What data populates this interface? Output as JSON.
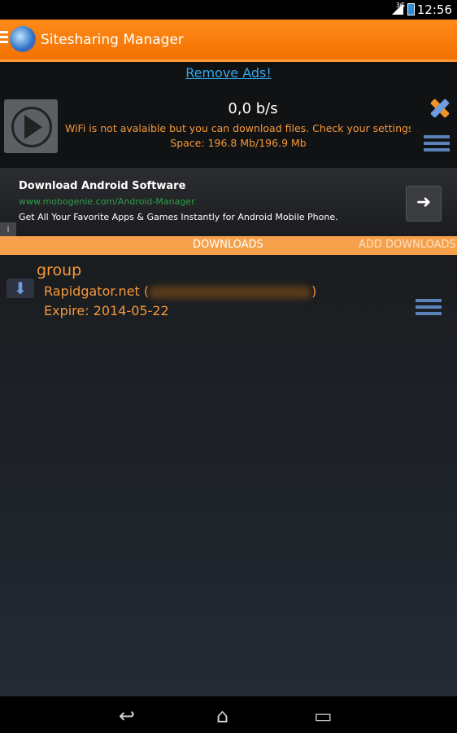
{
  "status_bar": {
    "network": "3G",
    "time": "12:56"
  },
  "app_bar": {
    "title": "Sitesharing Manager"
  },
  "remove_ads": {
    "label": "Remove Ads!"
  },
  "transfer": {
    "speed": "0,0 b/s",
    "message": "WiFi is not avalaible but you can download files. Check your settings to",
    "space": "Space: 196.8 Mb/196.9 Mb"
  },
  "ad": {
    "title": "Download Android Software",
    "url": "www.mobogenie.com/Android-Manager",
    "text": "Get All Your Favorite Apps & Games Instantly for Android Mobile Phone."
  },
  "tabs": [
    {
      "label": "DOWNLOADS"
    },
    {
      "label": "ADD DOWNLOADS"
    }
  ],
  "downloads": [
    {
      "group": "group",
      "host_prefix": "Rapidgator.net (",
      "host_suffix": ")",
      "expire": "Expire: 2014-05-22"
    }
  ],
  "icons": [
    "hamburger-menu-icon",
    "app-logo-icon",
    "play-icon",
    "close-icon",
    "menu-icon",
    "arrow-right-icon",
    "info-icon",
    "download-arrow-icon",
    "back-icon",
    "home-icon",
    "recent-apps-icon"
  ],
  "colors": {
    "accent": "#f27200",
    "orange_text": "#f6983a",
    "link": "#35a8e8"
  }
}
